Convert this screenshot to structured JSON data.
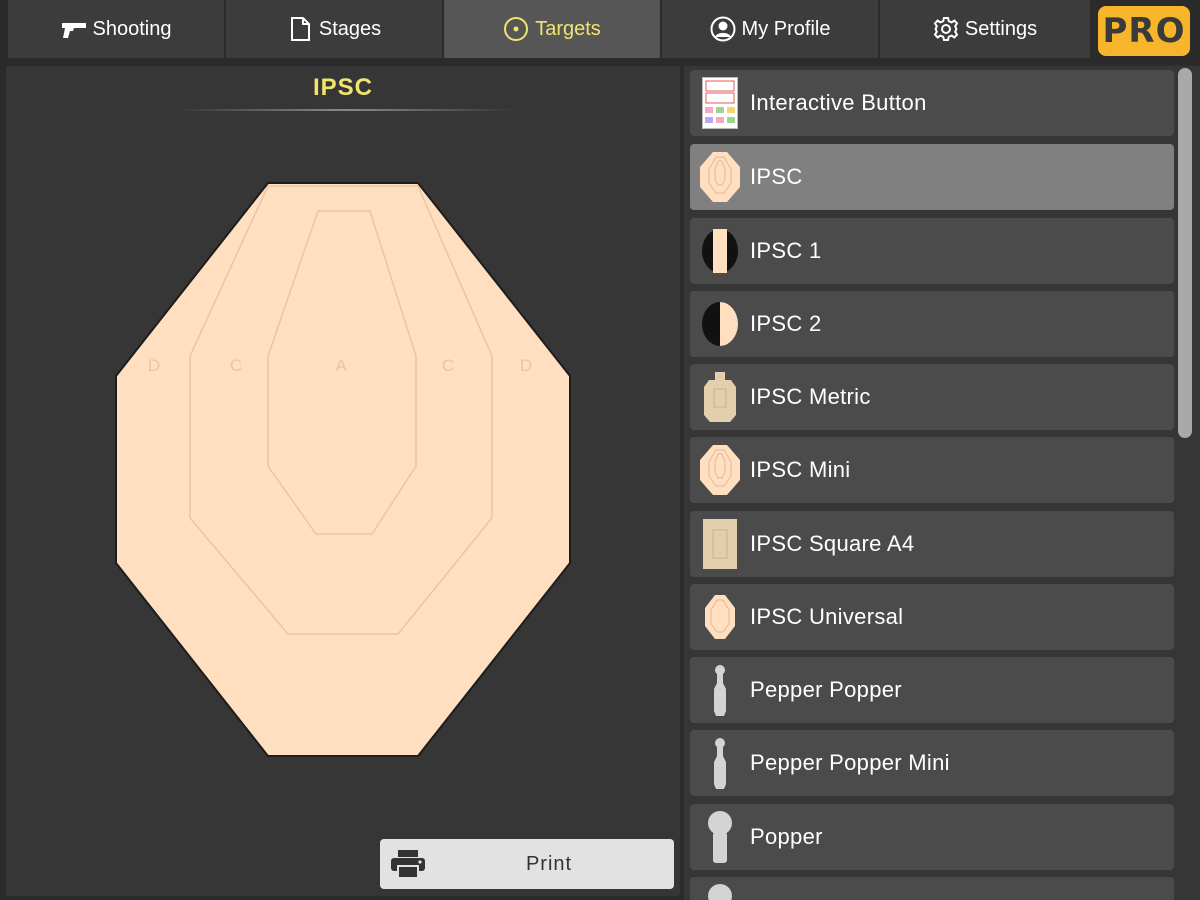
{
  "tabs": [
    {
      "label": "Shooting",
      "icon": "pistol-icon"
    },
    {
      "label": "Stages",
      "icon": "document-icon"
    },
    {
      "label": "Targets",
      "icon": "target-icon",
      "active": true
    },
    {
      "label": "My Profile",
      "icon": "profile-icon"
    },
    {
      "label": "Settings",
      "icon": "gear-icon"
    }
  ],
  "pro_badge": "PRO",
  "preview": {
    "title": "IPSC",
    "zone_labels": [
      "D",
      "C",
      "A",
      "C",
      "D"
    ],
    "print_label": "Print"
  },
  "targets": [
    {
      "label": "Interactive Button",
      "icon": "interactive-button-icon"
    },
    {
      "label": "IPSC",
      "icon": "ipsc-target-icon",
      "selected": true
    },
    {
      "label": "IPSC 1",
      "icon": "ipsc-1-target-icon"
    },
    {
      "label": "IPSC 2",
      "icon": "ipsc-2-target-icon"
    },
    {
      "label": "IPSC Metric",
      "icon": "ipsc-metric-target-icon"
    },
    {
      "label": "IPSC Mini",
      "icon": "ipsc-mini-target-icon"
    },
    {
      "label": "IPSC Square A4",
      "icon": "ipsc-square-a4-target-icon"
    },
    {
      "label": "IPSC Universal",
      "icon": "ipsc-universal-target-icon"
    },
    {
      "label": "Pepper Popper",
      "icon": "pepper-popper-icon"
    },
    {
      "label": "Pepper Popper Mini",
      "icon": "pepper-popper-mini-icon"
    },
    {
      "label": "Popper",
      "icon": "popper-icon"
    }
  ],
  "colors": {
    "accent_yellow": "#f1e46e",
    "pro_orange": "#f7b52b",
    "target_fill": "#ffdfc0",
    "panel_bg": "#363636",
    "item_bg": "#4b4b4b",
    "item_selected_bg": "#808080"
  }
}
